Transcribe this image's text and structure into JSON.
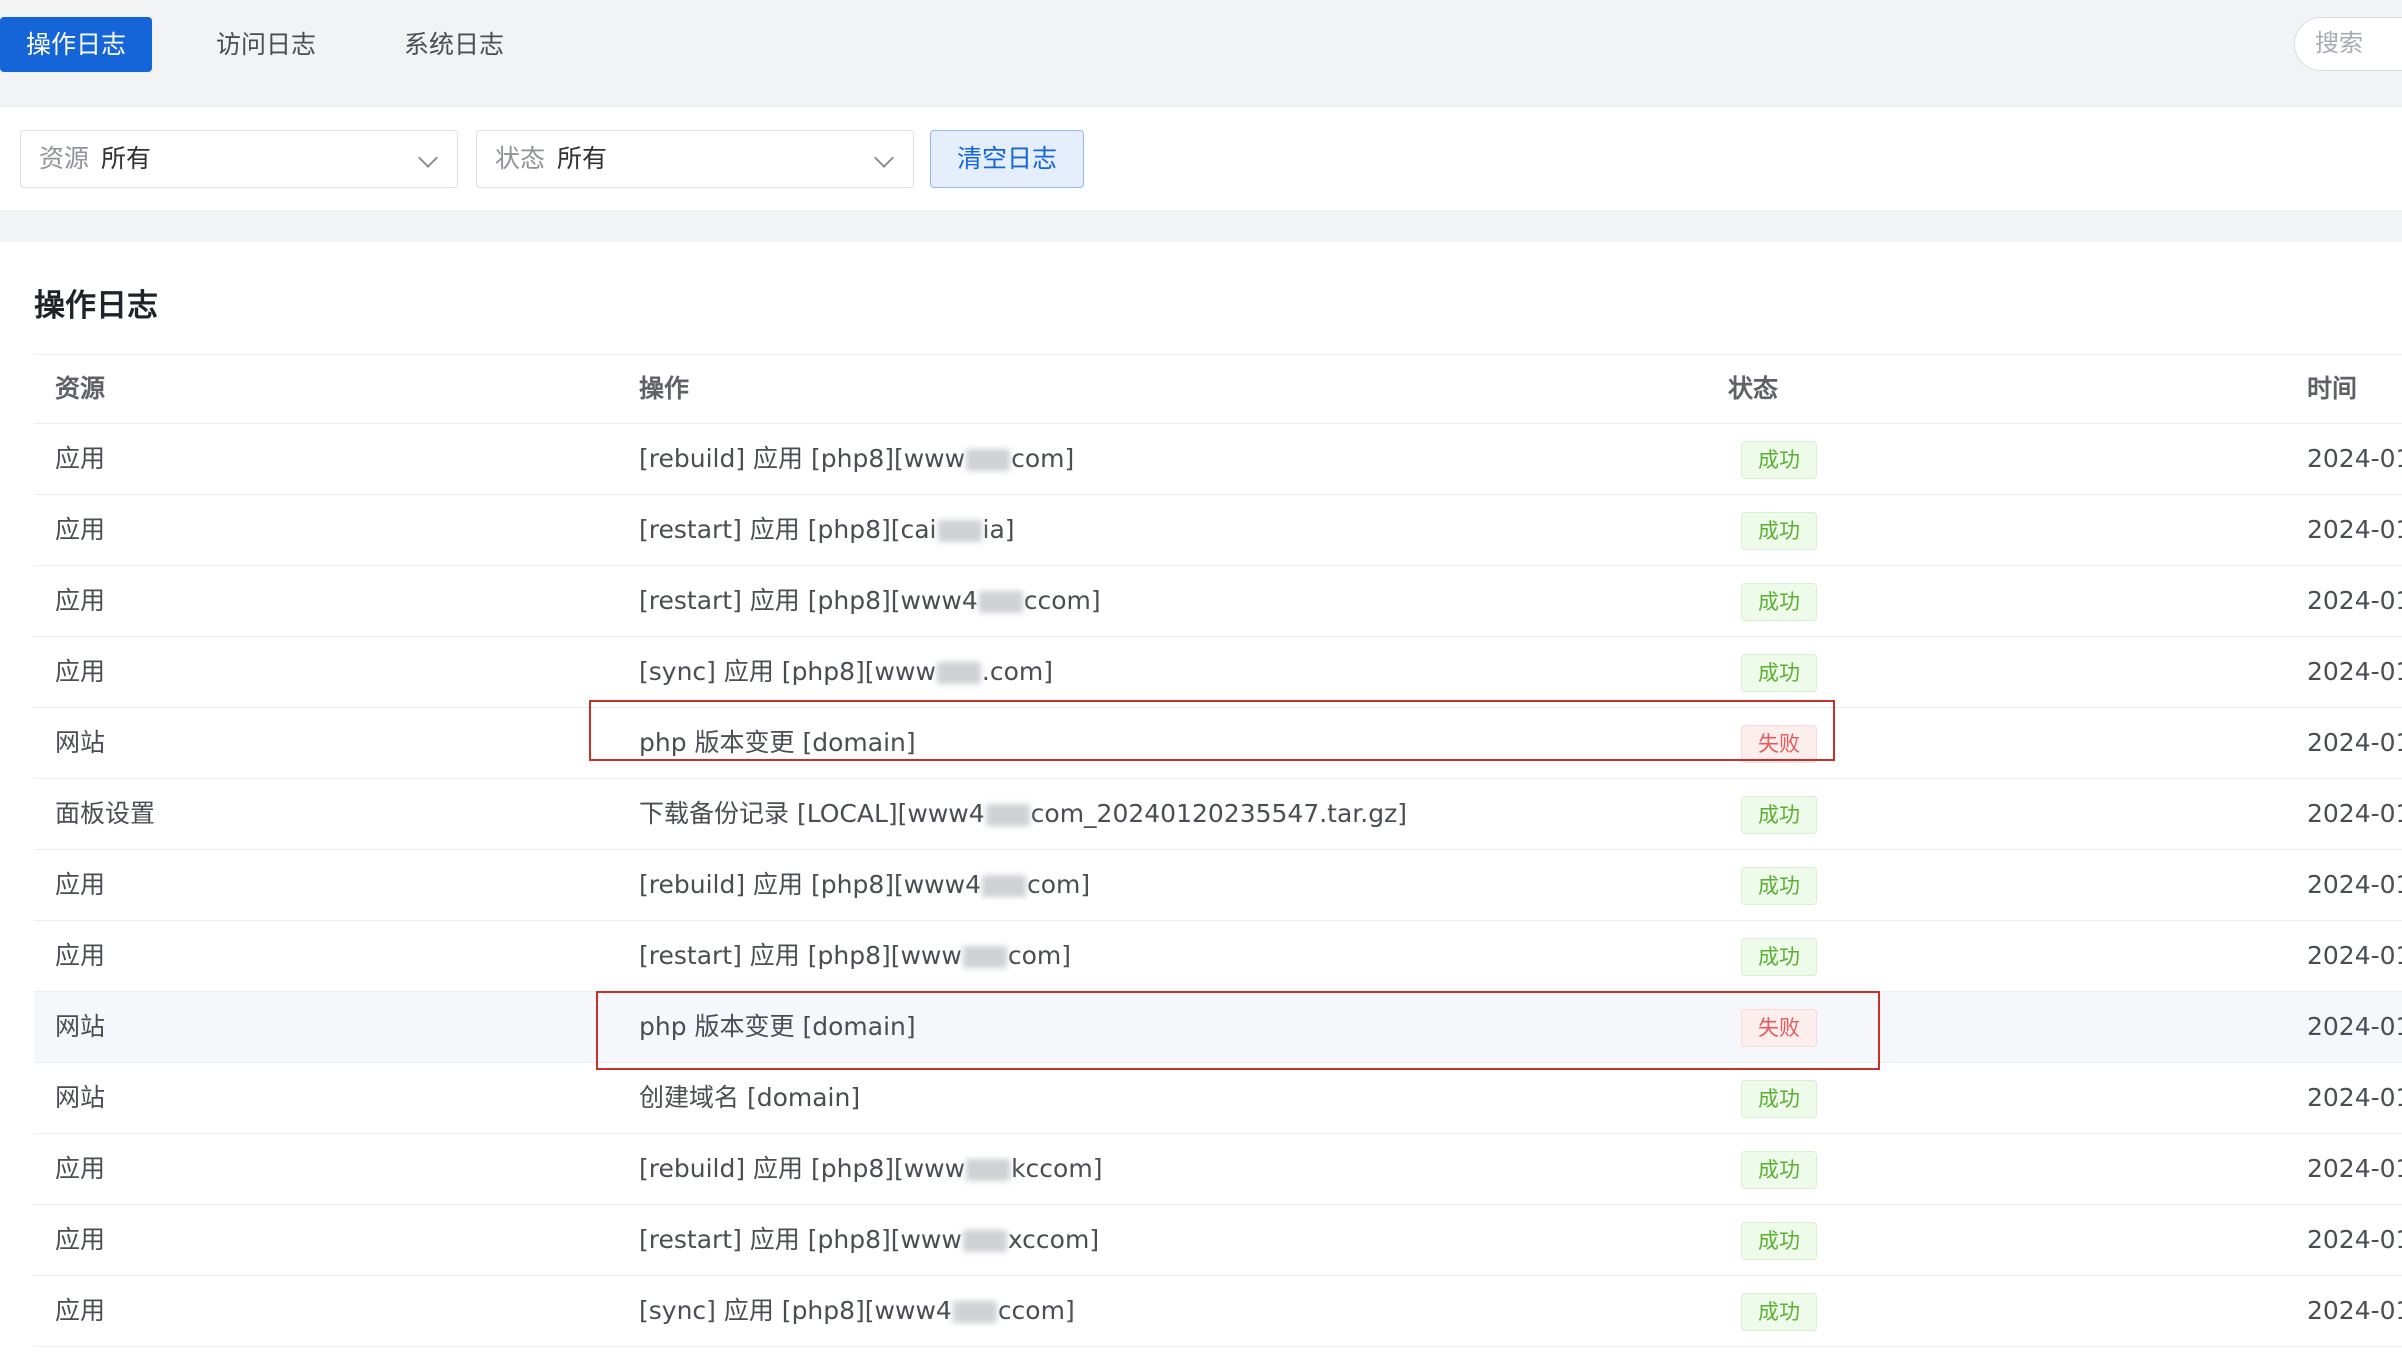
{
  "tabs": [
    {
      "label": "操作日志",
      "active": true
    },
    {
      "label": "访问日志",
      "active": false
    },
    {
      "label": "系统日志",
      "active": false
    }
  ],
  "search": {
    "placeholder": "搜索"
  },
  "filters": {
    "resource": {
      "prefix": "资源",
      "value": "所有"
    },
    "status": {
      "prefix": "状态",
      "value": "所有"
    },
    "clear_label": "清空日志"
  },
  "panel": {
    "title": "操作日志",
    "columns": [
      "资源",
      "操作",
      "状态",
      "时间"
    ],
    "rows": [
      {
        "resource": "应用",
        "op_pre": "[rebuild] 应用 [php8][www",
        "op_post": "com]",
        "status": "成功",
        "status_type": "ok",
        "time": "2024-01-"
      },
      {
        "resource": "应用",
        "op_pre": "[restart] 应用 [php8][cai",
        "op_post": "ia]",
        "status": "成功",
        "status_type": "ok",
        "time": "2024-01-"
      },
      {
        "resource": "应用",
        "op_pre": "[restart] 应用 [php8][www4",
        "op_post": "ccom]",
        "status": "成功",
        "status_type": "ok",
        "time": "2024-01-"
      },
      {
        "resource": "应用",
        "op_pre": "[sync] 应用 [php8][www",
        "op_post": ".com]",
        "status": "成功",
        "status_type": "ok",
        "time": "2024-01-"
      },
      {
        "resource": "网站",
        "op_pre": "php 版本变更 [domain]",
        "op_post": "",
        "status": "失败",
        "status_type": "fail",
        "time": "2024-01-"
      },
      {
        "resource": "面板设置",
        "op_pre": "下载备份记录 [LOCAL][www4",
        "op_post": "com_20240120235547.tar.gz]",
        "status": "成功",
        "status_type": "ok",
        "time": "2024-01-"
      },
      {
        "resource": "应用",
        "op_pre": "[rebuild] 应用 [php8][www4",
        "op_post": "com]",
        "status": "成功",
        "status_type": "ok",
        "time": "2024-01-"
      },
      {
        "resource": "应用",
        "op_pre": "[restart] 应用 [php8][www",
        "op_post": "com]",
        "status": "成功",
        "status_type": "ok",
        "time": "2024-01-"
      },
      {
        "resource": "网站",
        "op_pre": "php 版本变更 [domain]",
        "op_post": "",
        "status": "失败",
        "status_type": "fail",
        "time": "2024-01-"
      },
      {
        "resource": "网站",
        "op_pre": "创建域名 [domain]",
        "op_post": "",
        "status": "成功",
        "status_type": "ok",
        "time": "2024-01-"
      },
      {
        "resource": "应用",
        "op_pre": "[rebuild] 应用 [php8][www",
        "op_post": "kccom]",
        "status": "成功",
        "status_type": "ok",
        "time": "2024-01-"
      },
      {
        "resource": "应用",
        "op_pre": "[restart] 应用 [php8][www",
        "op_post": "xccom]",
        "status": "成功",
        "status_type": "ok",
        "time": "2024-01-"
      },
      {
        "resource": "应用",
        "op_pre": "[sync] 应用 [php8][www4",
        "op_post": "ccom]",
        "status": "成功",
        "status_type": "ok",
        "time": "2024-01-"
      }
    ]
  },
  "colors": {
    "primary": "#1565d8",
    "success": "#5bb033",
    "danger": "#e35b5b",
    "annotation": "#c9302c"
  }
}
